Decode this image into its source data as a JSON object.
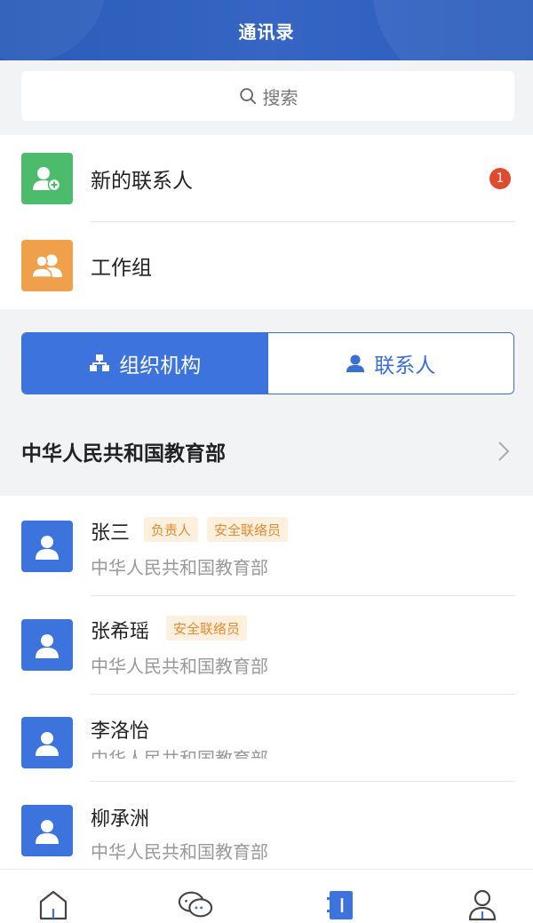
{
  "header": {
    "title": "通讯录"
  },
  "search": {
    "placeholder": "搜索",
    "icon": "search-icon"
  },
  "quick_items": [
    {
      "label": "新的联系人",
      "icon": "add-user-icon",
      "color": "#4cbb6c",
      "badge": "1"
    },
    {
      "label": "工作组",
      "icon": "group-icon",
      "color": "#f0a04b"
    }
  ],
  "tabs": {
    "org": {
      "label": "组织机构",
      "icon": "org-chart-icon",
      "active": true
    },
    "contacts": {
      "label": "联系人",
      "icon": "person-icon",
      "active": false
    }
  },
  "org_row": {
    "name": "中华人民共和国教育部"
  },
  "contacts": [
    {
      "name": "张三",
      "tags": [
        "负责人",
        "安全联络员"
      ],
      "org": "中华人民共和国教育部"
    },
    {
      "name": "张希瑶",
      "tags": [
        "安全联络员"
      ],
      "org": "中华人民共和国教育部"
    },
    {
      "name": "李洛怡",
      "tags": [],
      "org": "中华人民共和国教育部"
    },
    {
      "name": "柳承洲",
      "tags": [],
      "org": "中华人民共和国教育部"
    }
  ],
  "bottom_nav": [
    {
      "icon": "home-icon"
    },
    {
      "icon": "chat-icon"
    },
    {
      "icon": "contacts-book-icon",
      "active": true
    },
    {
      "icon": "profile-icon"
    }
  ],
  "colors": {
    "primary": "#3d73dd",
    "tag_bg": "#fdf0df",
    "tag_text": "#e68a2e",
    "badge": "#e04a2f"
  }
}
